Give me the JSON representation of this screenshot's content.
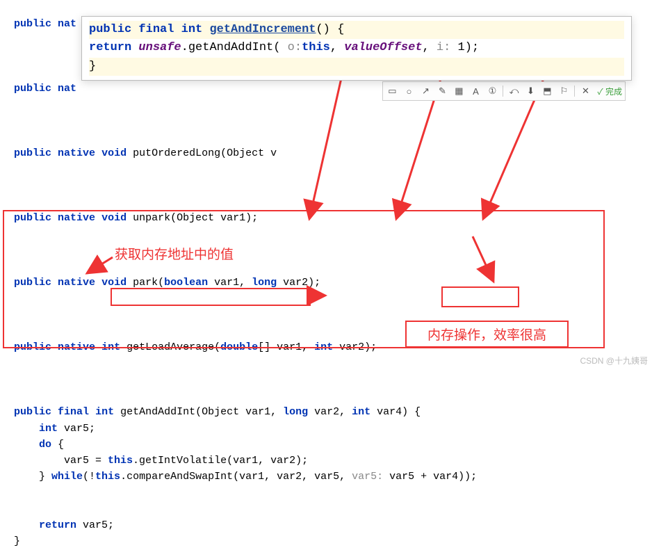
{
  "bg": {
    "l1a": "public",
    "l1b": "nat",
    "l2a": "public",
    "l2b": "nat",
    "l3_pub": "public",
    "l3_nat": "native",
    "l3_void": "void",
    "l3_rest": " putOrderedLong(Object v",
    "l4_pub": "public",
    "l4_nat": "native",
    "l4_void": "void",
    "l4_rest": " unpark(Object var1);",
    "l5_pub": "public",
    "l5_nat": "native",
    "l5_void": "void",
    "l5_rest": " park(",
    "l5_bool": "boolean",
    "l5_rest2": " var1, ",
    "l5_long": "long",
    "l5_rest3": " var2);",
    "l6_pub": "public",
    "l6_nat": "native",
    "l6_int": "int",
    "l6_rest": " getLoadAverage(",
    "l6_dbl": "double",
    "l6_rest2": "[] var1, ",
    "l6_int2": "int",
    "l6_rest3": " var2);",
    "m_pub": "public",
    "m_fin": "final",
    "m_int": "int",
    "m_name": " getAndAddInt(Object var1, ",
    "m_long": "long",
    "m_p2": " var2, ",
    "m_int2": "int",
    "m_p3": " var4) {",
    "m_int3": "int",
    "m_v5": " var5;",
    "m_do": "do",
    "m_brace": " {",
    "m_body": "        var5 = ",
    "m_this": "this",
    "m_body2": ".getIntVolatile(var1, var2);",
    "m_wh_close": "    } ",
    "m_while": "while",
    "m_wh_rest": "(!",
    "m_this2": "this",
    "m_wh_rest2": ".compareAndSwapInt(var1, var2, var5, ",
    "m_hint": "var5:",
    "m_wh_rest3": " var5 + var4));",
    "m_ret": "return",
    "m_ret2": " var5;",
    "m_end": "}"
  },
  "popup": {
    "l1_pub": "public",
    "l1_fin": "final",
    "l1_int": "int",
    "l1_method": "getAndIncrement",
    "l1_rest": "()",
    "l1_brace": " {",
    "l2_ret": "return",
    "l2_sp": " ",
    "l2_unsafe": "unsafe",
    "l2_rest": ".getAndAddInt( ",
    "l2_hint1": "o:",
    "l2_this": "this",
    "l2_rest2": ", ",
    "l2_vo": "valueOffset",
    "l2_rest3": ", ",
    "l2_hint2": "i:",
    "l2_rest4": " 1);",
    "l3_brace": "}"
  },
  "toolbar": {
    "done": "完成"
  },
  "annotations": {
    "label1": "获取内存地址中的值",
    "label2": "内存操作，效率很高"
  },
  "watermark": "CSDN @十九姨哥"
}
